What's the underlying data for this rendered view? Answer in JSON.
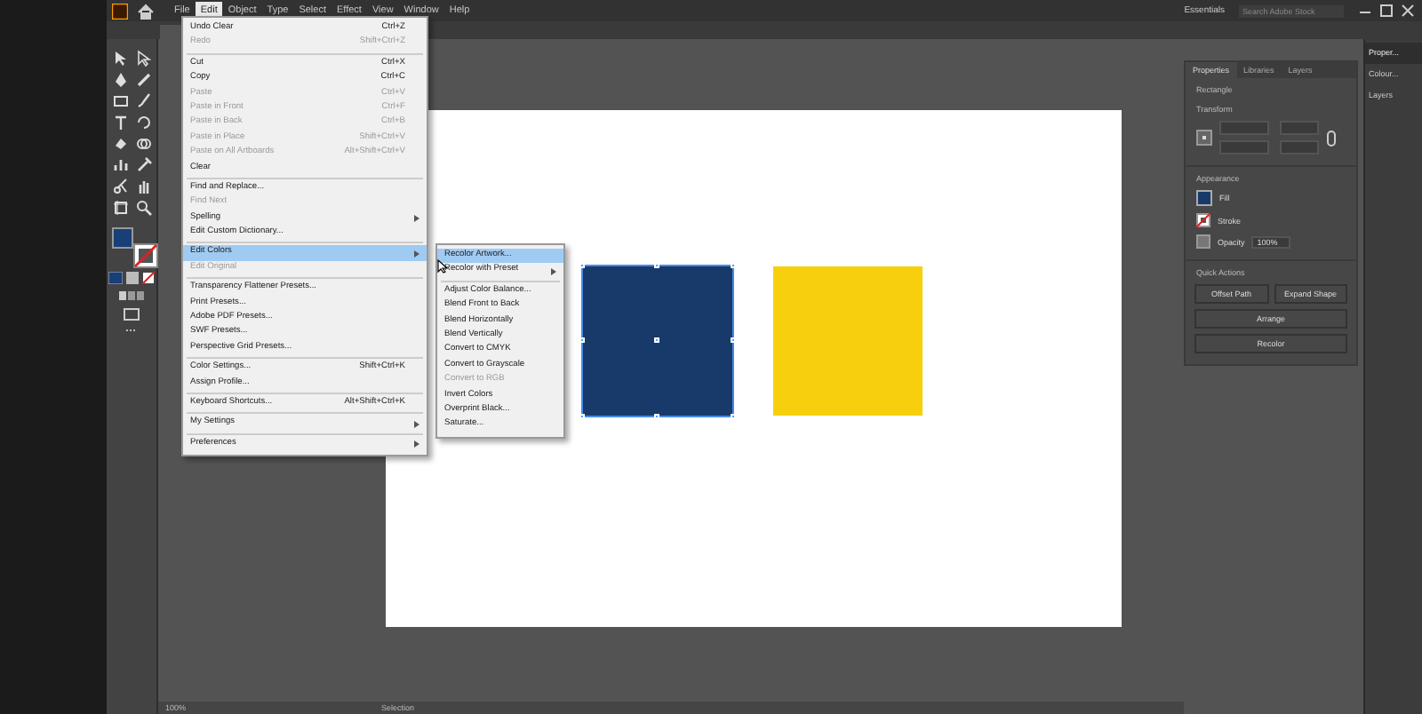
{
  "menubar": [
    {
      "label": "File",
      "selected": false
    },
    {
      "label": "Edit",
      "selected": true
    },
    {
      "label": "Object",
      "selected": false
    },
    {
      "label": "Type",
      "selected": false
    },
    {
      "label": "Select",
      "selected": false
    },
    {
      "label": "Effect",
      "selected": false
    },
    {
      "label": "View",
      "selected": false
    },
    {
      "label": "Window",
      "selected": false
    },
    {
      "label": "Help",
      "selected": false
    }
  ],
  "workspace": {
    "label": "Essentials",
    "search_placeholder": "Search Adobe Stock"
  },
  "edit_menu": {
    "groups": [
      [
        {
          "label": "Undo Clear",
          "shortcut": "Ctrl+Z",
          "disabled": false,
          "selected": false,
          "submenu": false
        },
        {
          "label": "Redo",
          "shortcut": "Shift+Ctrl+Z",
          "disabled": true,
          "selected": false,
          "submenu": false
        }
      ],
      [
        {
          "label": "Cut",
          "shortcut": "Ctrl+X",
          "disabled": false,
          "selected": false,
          "submenu": false
        },
        {
          "label": "Copy",
          "shortcut": "Ctrl+C",
          "disabled": false,
          "selected": false,
          "submenu": false
        },
        {
          "label": "Paste",
          "shortcut": "Ctrl+V",
          "disabled": true,
          "selected": false,
          "submenu": false
        },
        {
          "label": "Paste in Front",
          "shortcut": "Ctrl+F",
          "disabled": true,
          "selected": false,
          "submenu": false
        },
        {
          "label": "Paste in Back",
          "shortcut": "Ctrl+B",
          "disabled": true,
          "selected": false,
          "submenu": false
        },
        {
          "label": "Paste in Place",
          "shortcut": "Shift+Ctrl+V",
          "disabled": true,
          "selected": false,
          "submenu": false
        },
        {
          "label": "Paste on All Artboards",
          "shortcut": "Alt+Shift+Ctrl+V",
          "disabled": true,
          "selected": false,
          "submenu": false
        },
        {
          "label": "Clear",
          "disabled": false,
          "selected": false,
          "submenu": false
        }
      ],
      [
        {
          "label": "Find and Replace...",
          "disabled": false,
          "selected": false,
          "submenu": false
        },
        {
          "label": "Find Next",
          "disabled": true,
          "selected": false,
          "submenu": false
        },
        {
          "label": "Spelling",
          "disabled": false,
          "selected": false,
          "submenu": true
        },
        {
          "label": "Edit Custom Dictionary...",
          "disabled": false,
          "selected": false,
          "submenu": false
        }
      ],
      [
        {
          "label": "Edit Colors",
          "disabled": false,
          "selected": true,
          "submenu": true
        },
        {
          "label": "Edit Original",
          "disabled": true,
          "selected": false,
          "submenu": false
        }
      ],
      [
        {
          "label": "Transparency Flattener Presets...",
          "disabled": false,
          "selected": false,
          "submenu": false
        },
        {
          "label": "Print Presets...",
          "disabled": false,
          "selected": false,
          "submenu": false
        },
        {
          "label": "Adobe PDF Presets...",
          "disabled": false,
          "selected": false,
          "submenu": false
        },
        {
          "label": "SWF Presets...",
          "disabled": false,
          "selected": false,
          "submenu": false
        },
        {
          "label": "Perspective Grid Presets...",
          "disabled": false,
          "selected": false,
          "submenu": false
        }
      ],
      [
        {
          "label": "Color Settings...",
          "shortcut": "Shift+Ctrl+K",
          "disabled": false,
          "selected": false,
          "submenu": false
        },
        {
          "label": "Assign Profile...",
          "disabled": false,
          "selected": false,
          "submenu": false
        }
      ],
      [
        {
          "label": "Keyboard Shortcuts...",
          "shortcut": "Alt+Shift+Ctrl+K",
          "disabled": false,
          "selected": false,
          "submenu": false
        }
      ],
      [
        {
          "label": "My Settings",
          "disabled": false,
          "selected": false,
          "submenu": true
        }
      ],
      [
        {
          "label": "Preferences",
          "disabled": false,
          "selected": false,
          "submenu": true
        }
      ]
    ]
  },
  "edit_colors_submenu": {
    "groups": [
      [
        {
          "label": "Recolor Artwork...",
          "disabled": false,
          "selected": true,
          "submenu": false
        },
        {
          "label": "Recolor with Preset",
          "disabled": false,
          "selected": false,
          "submenu": true
        }
      ],
      [
        {
          "label": "Adjust Color Balance...",
          "disabled": false,
          "selected": false,
          "submenu": false
        },
        {
          "label": "Blend Front to Back",
          "disabled": false,
          "selected": false,
          "submenu": false
        },
        {
          "label": "Blend Horizontally",
          "disabled": false,
          "selected": false,
          "submenu": false
        },
        {
          "label": "Blend Vertically",
          "disabled": false,
          "selected": false,
          "submenu": false
        },
        {
          "label": "Convert to CMYK",
          "disabled": false,
          "selected": false,
          "submenu": false
        },
        {
          "label": "Convert to Grayscale",
          "disabled": false,
          "selected": false,
          "submenu": false
        },
        {
          "label": "Convert to RGB",
          "disabled": true,
          "selected": false,
          "submenu": false
        },
        {
          "label": "Invert Colors",
          "disabled": false,
          "selected": false,
          "submenu": false
        },
        {
          "label": "Overprint Black...",
          "disabled": false,
          "selected": false,
          "submenu": false
        },
        {
          "label": "Saturate...",
          "disabled": false,
          "selected": false,
          "submenu": false
        }
      ]
    ]
  },
  "toolbar": {
    "fill_swatch": {
      "color": "#173f78"
    }
  },
  "artboard": {
    "shapes": [
      {
        "kind": "rectangle",
        "color": "#173a6b",
        "selected": true
      },
      {
        "kind": "rectangle",
        "color": "#f8cf0c",
        "selected": false
      }
    ]
  },
  "properties_panel": {
    "tabs": [
      {
        "label": "Properties",
        "selected": true
      },
      {
        "label": "Libraries",
        "selected": false
      },
      {
        "label": "Layers",
        "selected": false
      }
    ],
    "object_type": "Rectangle",
    "transform_title": "Transform",
    "appearance_title": "Appearance",
    "appearance": [
      {
        "kind": "fill",
        "label": "Fill",
        "color": "#173a6b"
      },
      {
        "kind": "stroke",
        "label": "Stroke"
      },
      {
        "kind": "opacity",
        "label": "Opacity",
        "value": "100%"
      }
    ],
    "quick_actions_title": "Quick Actions",
    "quick_actions": [
      {
        "label": "Offset Path",
        "wide": false
      },
      {
        "label": "Expand Shape",
        "wide": false
      },
      {
        "label": "Arrange",
        "wide": true
      },
      {
        "label": "Recolor",
        "wide": true
      }
    ]
  },
  "dock": [
    {
      "label": "Proper...",
      "selected": true
    },
    {
      "label": "Colour...",
      "selected": false
    },
    {
      "label": "Layers",
      "selected": false
    }
  ],
  "status_bar": {
    "zoom": "100%",
    "tool": "Selection"
  }
}
